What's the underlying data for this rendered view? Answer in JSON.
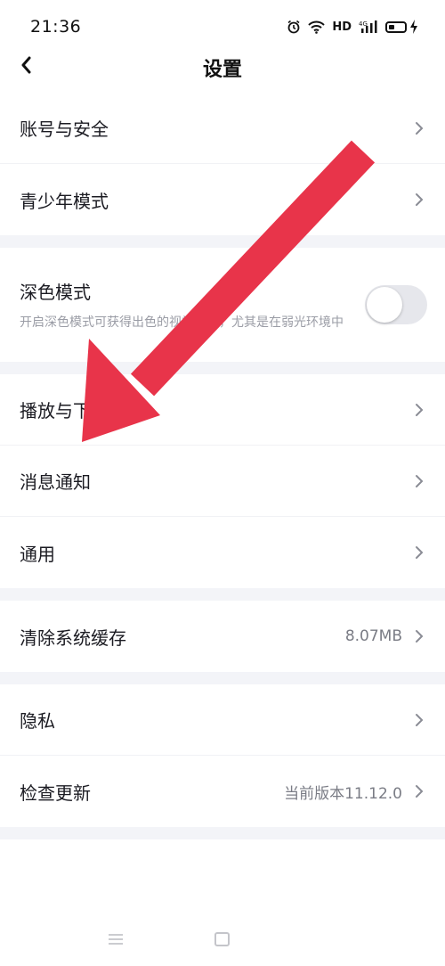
{
  "status_bar": {
    "time": "21:36",
    "network_label": "HD",
    "signal_label": "4G"
  },
  "header": {
    "title": "设置",
    "back_icon": "chevron-left-icon"
  },
  "groups": [
    {
      "items": [
        {
          "label": "账号与安全",
          "value": ""
        },
        {
          "label": "青少年模式",
          "value": ""
        }
      ]
    },
    {
      "dark_mode": {
        "title": "深色模式",
        "description": "开启深色模式可获得出色的视觉体验，尤其是在弱光环境中",
        "enabled": false
      }
    },
    {
      "items": [
        {
          "label": "播放与下载",
          "value": ""
        },
        {
          "label": "消息通知",
          "value": ""
        },
        {
          "label": "通用",
          "value": ""
        }
      ]
    },
    {
      "items": [
        {
          "label": "清除系统缓存",
          "value": "8.07MB"
        }
      ]
    },
    {
      "items": [
        {
          "label": "隐私",
          "value": ""
        },
        {
          "label": "检查更新",
          "value": "当前版本11.12.0"
        }
      ]
    }
  ],
  "colors": {
    "annotation_arrow": "#e8344a",
    "group_gap": "#f3f4f8",
    "secondary_text": "#7a7c85"
  }
}
